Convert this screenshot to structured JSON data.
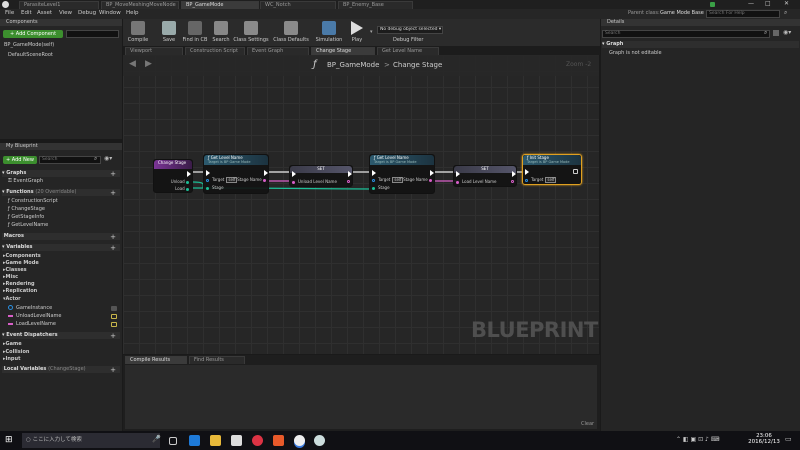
{
  "titlebar": {
    "tabs": [
      "ParasiteLevel1",
      "BP_MoveMeshingMoveNode",
      "BP_GameMode",
      "WC_Notch",
      "BP_Enemy_Base"
    ],
    "parent_class_label": "Parent class:",
    "parent_class_value": "Game Mode Base",
    "help_placeholder": "Search For Help"
  },
  "menu": [
    "File",
    "Edit",
    "Asset",
    "View",
    "Debug",
    "Window",
    "Help"
  ],
  "components": {
    "header": "Components",
    "add_button": "+ Add Component",
    "self_item": "BP_GameMode(self)",
    "root_item": "DefaultSceneRoot"
  },
  "toolbar": {
    "buttons": [
      "Compile",
      "Save",
      "Find in CB",
      "Search",
      "Class Settings",
      "Class Defaults",
      "Simulation",
      "Play"
    ],
    "debug_select": "No debug object selected",
    "debug_label": "Debug Filter"
  },
  "editor_tabs": [
    "Viewport",
    "Construction Script",
    "Event Graph",
    "Change Stage",
    "Get Level Name"
  ],
  "graph": {
    "breadcrumb_root": "BP_GameMode",
    "breadcrumb_sep": ">",
    "breadcrumb_leaf": "Change Stage",
    "zoom": "Zoom -2",
    "watermark": "BLUEPRINT"
  },
  "my_blueprint": {
    "header": "My Blueprint",
    "add_new": "+ Add New",
    "search_placeholder": "Search",
    "graphs_label": "Graphs",
    "event_graph": "EventGraph",
    "functions_label": "Functions",
    "functions_note": "(20 Overridable)",
    "functions": [
      "ConstructionScript",
      "ChangeStage",
      "GetStageInfo",
      "GetLevelName"
    ],
    "macros_label": "Macros",
    "variables_label": "Variables",
    "variable_categories": [
      "Components",
      "Game Mode",
      "Classes",
      "Misc",
      "Rendering",
      "Replication",
      "Actor"
    ],
    "variables": [
      "GameInstance",
      "UnloadLevelName",
      "LoadLevelName"
    ],
    "dispatchers_label": "Event Dispatchers",
    "dispatcher_categories": [
      "Game",
      "Collision",
      "Input"
    ],
    "local_vars_label": "Local Variables",
    "local_vars_note": "(ChangeStage)"
  },
  "nodes": {
    "change_stage": {
      "title": "Change Stage",
      "pins": [
        "Unload",
        "Load"
      ]
    },
    "get_level_name_1": {
      "title": "Get Level Name",
      "subtitle": "Target is BP Game Mode",
      "pins": [
        "Target",
        "Stage"
      ],
      "self": "self",
      "out_pin": "Stage Name"
    },
    "set_1": {
      "title": "SET",
      "pin": "Unload Level Name"
    },
    "get_level_name_2": {
      "title": "Get Level Name",
      "subtitle": "Target is BP Game Mode",
      "pins": [
        "Target",
        "Stage"
      ],
      "self": "self",
      "out_pin": "Stage Name"
    },
    "set_2": {
      "title": "SET",
      "pin": "Load Level Name"
    },
    "init_stage": {
      "title": "Init Stage",
      "subtitle": "Target is BP Game Mode",
      "pin": "Target",
      "self": "self"
    }
  },
  "results": {
    "tabs": [
      "Compile Results",
      "Find Results"
    ],
    "clear": "Clear"
  },
  "details": {
    "header": "Details",
    "search_placeholder": "Search",
    "section": "Graph",
    "message": "Graph is not editable"
  },
  "taskbar": {
    "search_placeholder": "ここに入力して検索",
    "time": "23:06",
    "date": "2016/12/13"
  },
  "colors": {
    "accent_blue": "#3f7fb4",
    "function_header": "#2c5a6e",
    "set_header": "#4a4a5a",
    "event_header": "#6e2c8a",
    "selected": "#e0a020",
    "pin_stage": "#1bbf96",
    "pin_string": "#d85fc8",
    "pin_object": "#2b8fe0"
  }
}
